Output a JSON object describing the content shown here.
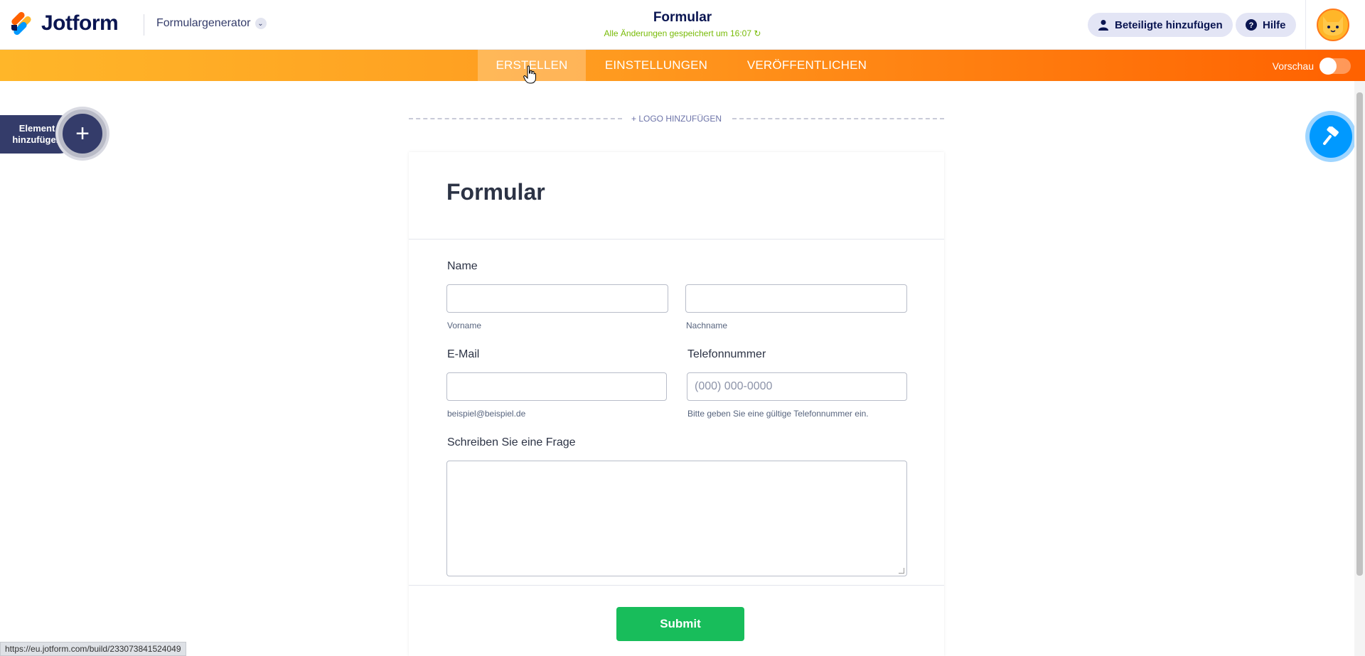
{
  "header": {
    "brand": "Jotform",
    "builder_menu": "Formulargenerator",
    "form_title": "Formular",
    "save_status": "Alle Änderungen gespeichert um 16:07",
    "add_participants": "Beteiligte hinzufügen",
    "help": "Hilfe"
  },
  "nav": {
    "tabs": [
      {
        "label": "ERSTELLEN",
        "active": true
      },
      {
        "label": "EINSTELLUNGEN",
        "active": false
      },
      {
        "label": "VERÖFFENTLICHEN",
        "active": false
      }
    ],
    "preview_label": "Vorschau",
    "preview_on": false
  },
  "sidebar": {
    "add_element_label": "Element hinzufügen"
  },
  "form": {
    "logo_add": "+ LOGO HINZUFÜGEN",
    "heading": "Formular",
    "name_label": "Name",
    "first_name_sub": "Vorname",
    "last_name_sub": "Nachname",
    "email_label": "E-Mail",
    "email_sub": "beispiel@beispiel.de",
    "phone_label": "Telefonnummer",
    "phone_placeholder": "(000) 000-0000",
    "phone_sub": "Bitte geben Sie eine gültige Telefonnummer ein.",
    "question_label": "Schreiben Sie eine Frage",
    "submit": "Submit"
  },
  "status_url": "https://eu.jotform.com/build/233073841524049",
  "colors": {
    "nav_gradient_start": "#ffb629",
    "nav_gradient_end": "#ff6100",
    "submit_green": "#18bd5b",
    "designer_blue": "#0099ff",
    "saved_green": "#78bb07"
  }
}
